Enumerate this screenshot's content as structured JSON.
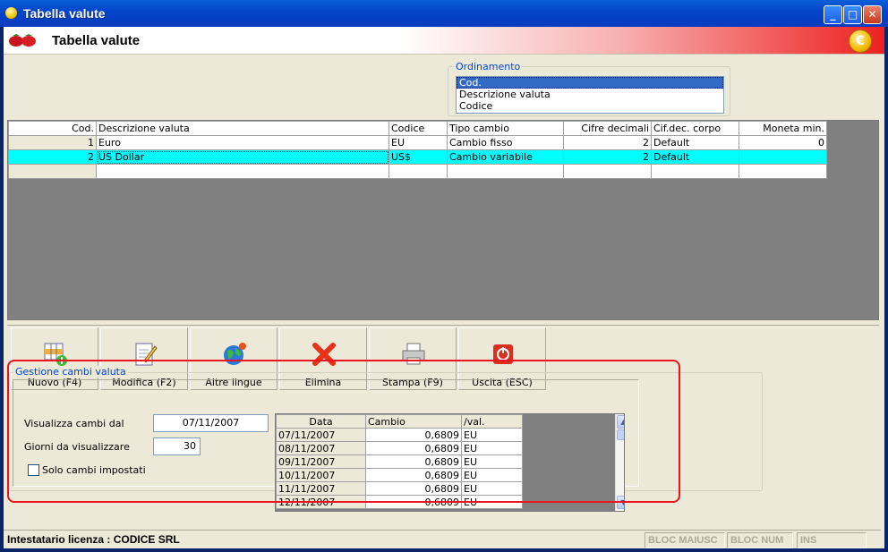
{
  "window": {
    "title": "Tabella valute",
    "minimize_glyph": "_",
    "maximize_glyph": "□",
    "close_glyph": "✕"
  },
  "header": {
    "title": "Tabella valute",
    "coin_glyph": "€"
  },
  "ordinamento": {
    "label": "Ordinamento",
    "options": [
      "Cod.",
      "Descrizione valuta",
      "Codice"
    ],
    "selected": "Cod."
  },
  "grid": {
    "columns": [
      "Cod.",
      "Descrizione valuta",
      "Codice",
      "Tipo cambio",
      "Cifre decimali",
      "Cif.dec. corpo",
      "Moneta min."
    ],
    "rows": [
      {
        "cod": "1",
        "descrizione": "Euro",
        "codice": "EU",
        "tipo": "Cambio fisso",
        "cifre": "2",
        "cifdec": "Default",
        "moneta": "0"
      },
      {
        "cod": "2",
        "descrizione": "US Dollar",
        "codice": "US$",
        "tipo": "Cambio variabile",
        "cifre": "2",
        "cifdec": "Default",
        "moneta": ""
      }
    ]
  },
  "toolbar": {
    "nuovo": "Nuovo (F4)",
    "modifica": "Modifica (F2)",
    "altre_lingue": "Altre lingue",
    "elimina": "Elimina",
    "stampa": "Stampa (F9)",
    "uscita": "Uscita (ESC)"
  },
  "gestione": {
    "label": "Gestione cambi valuta",
    "visualizza_label": "Visualizza cambi dal",
    "visualizza_value": "07/11/2007",
    "giorni_label": "Giorni da visualizzare",
    "giorni_value": "30",
    "solo_label": "Solo cambi impostati",
    "solo_checked": false,
    "rates_columns": [
      "Data",
      "Cambio",
      "/val."
    ],
    "rates": [
      {
        "data": "07/11/2007",
        "cambio": "0,6809",
        "val": "EU"
      },
      {
        "data": "08/11/2007",
        "cambio": "0,6809",
        "val": "EU"
      },
      {
        "data": "09/11/2007",
        "cambio": "0,6809",
        "val": "EU"
      },
      {
        "data": "10/11/2007",
        "cambio": "0,6809",
        "val": "EU"
      },
      {
        "data": "11/11/2007",
        "cambio": "0,6809",
        "val": "EU"
      },
      {
        "data": "12/11/2007",
        "cambio": "0,6809",
        "val": "EU"
      }
    ]
  },
  "status": {
    "licenza": "Intestatario licenza : CODICE SRL",
    "caps": "BLOC MAIUSC",
    "num": "BLOC NUM",
    "ins": "INS"
  },
  "colors": {
    "highlight_row": "#00ffff",
    "selection": "#316ac5",
    "annotation_red": "#e8141e",
    "groupbox_label": "#0046d5"
  }
}
